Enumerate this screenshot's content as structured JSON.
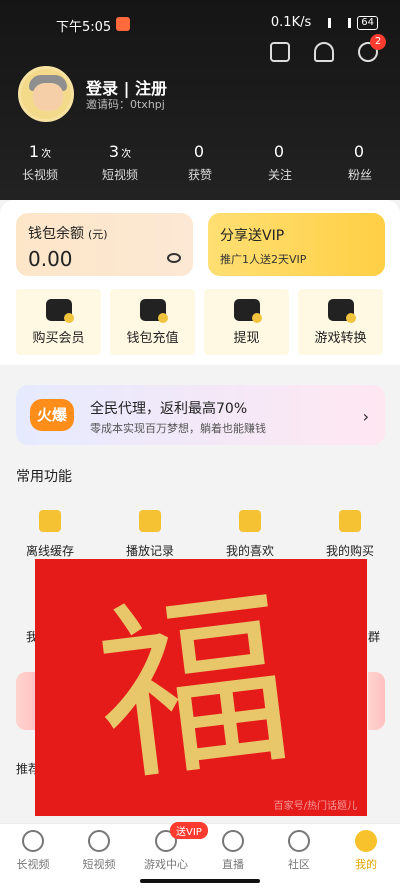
{
  "status": {
    "time": "下午5:05",
    "speed": "0.1K/s",
    "battery": "64"
  },
  "header": {
    "notification_count": "2",
    "login_label": "登录 | 注册",
    "invite_label": "邀请码：0txhpj"
  },
  "stats": [
    {
      "num": "1",
      "unit": "次",
      "label": "长视频"
    },
    {
      "num": "3",
      "unit": "次",
      "label": "短视频"
    },
    {
      "num": "0",
      "unit": "",
      "label": "获赞"
    },
    {
      "num": "0",
      "unit": "",
      "label": "关注"
    },
    {
      "num": "0",
      "unit": "",
      "label": "粉丝"
    }
  ],
  "wallet": {
    "title": "钱包余额",
    "unit": "(元)",
    "value": "0.00"
  },
  "vip_share": {
    "title": "分享送VIP",
    "subtitle": "推广1人送2天VIP"
  },
  "actions": [
    {
      "label": "购买会员",
      "icon": "crown-icon"
    },
    {
      "label": "钱包充值",
      "icon": "wallet-icon"
    },
    {
      "label": "提现",
      "icon": "withdraw-icon"
    },
    {
      "label": "游戏转换",
      "icon": "money-bag-icon"
    }
  ],
  "promo": {
    "badge": "火爆",
    "title": "全民代理，返利最高70%",
    "subtitle": "零成本实现百万梦想，躺着也能赚钱"
  },
  "section_title": "常用功能",
  "functions": [
    {
      "label": "离线缓存",
      "icon": "download-icon"
    },
    {
      "label": "播放记录",
      "icon": "history-icon"
    },
    {
      "label": "我的喜欢",
      "icon": "heart-icon"
    },
    {
      "label": "我的购买",
      "icon": "shopping-bag-icon"
    }
  ],
  "partial_text": {
    "left": "我",
    "right": "群",
    "recommend": "推荐"
  },
  "overlay": {
    "character": "福",
    "caption": "百家号/热门话题儿"
  },
  "tabs": [
    {
      "label": "长视频"
    },
    {
      "label": "短视频"
    },
    {
      "label": "游戏中心",
      "badge": "送VIP"
    },
    {
      "label": "直播"
    },
    {
      "label": "社区"
    },
    {
      "label": "我的"
    }
  ]
}
